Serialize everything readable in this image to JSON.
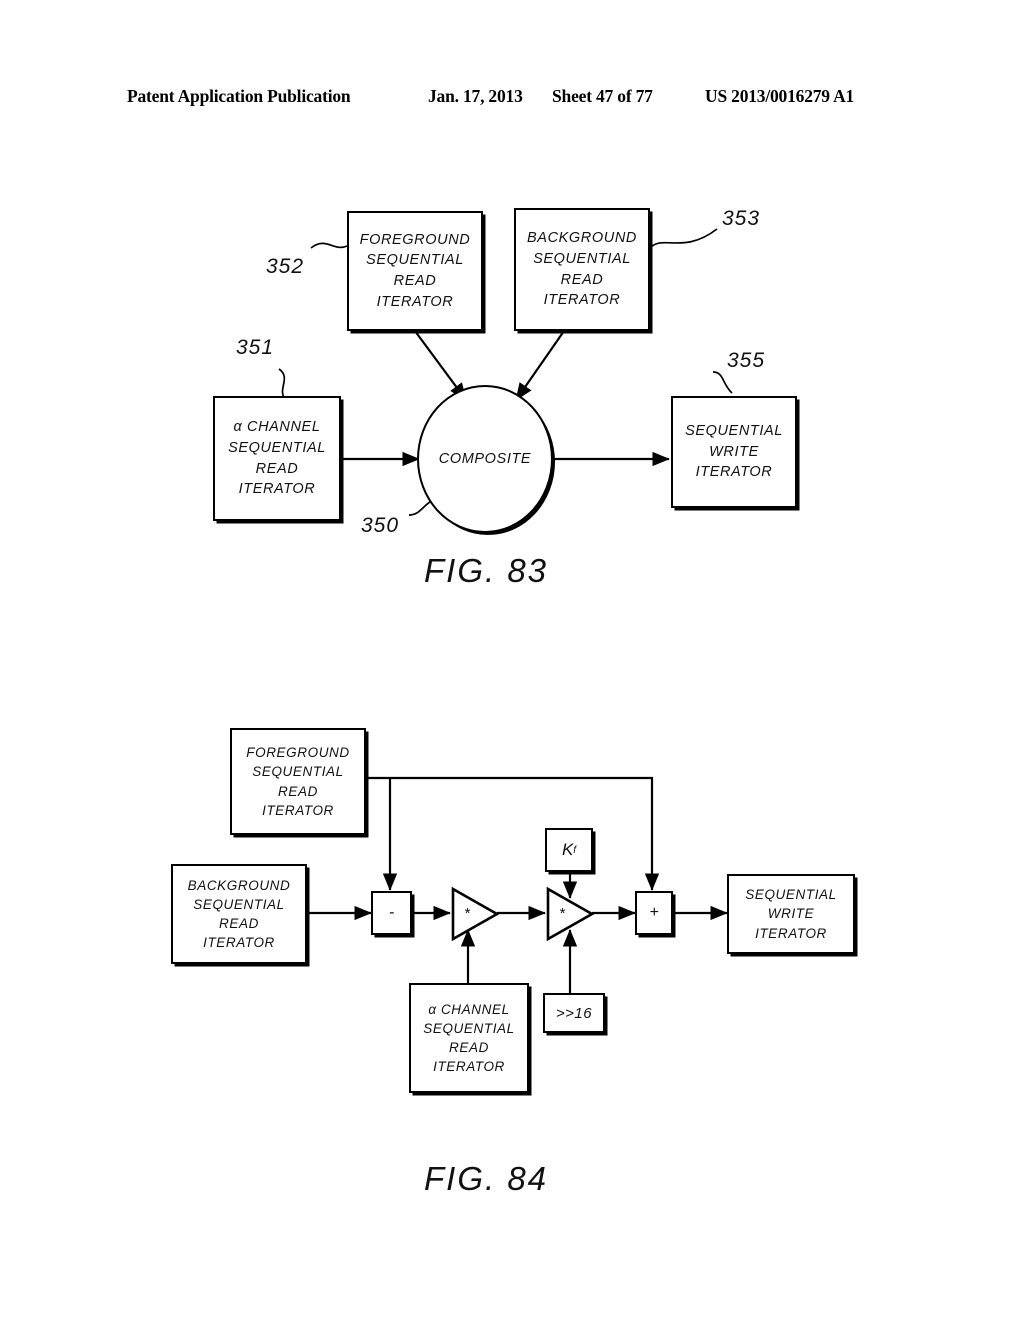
{
  "header": {
    "publication": "Patent Application Publication",
    "date": "Jan. 17, 2013",
    "sheet": "Sheet 47 of 77",
    "number": "US 2013/0016279 A1"
  },
  "figures": [
    {
      "id": "fig-83",
      "caption": "FIG. 83",
      "nodes": {
        "foreground_iterator": [
          "FOREGROUND",
          "SEQUENTIAL",
          "READ",
          "ITERATOR"
        ],
        "background_iterator": [
          "BACKGROUND",
          "SEQUENTIAL",
          "READ",
          "ITERATOR"
        ],
        "alpha_iterator": [
          "α CHANNEL",
          "SEQUENTIAL",
          "READ",
          "ITERATOR"
        ],
        "composite": "COMPOSITE",
        "write_iterator": [
          "SEQUENTIAL",
          "WRITE",
          "ITERATOR"
        ]
      },
      "refs": {
        "alpha": "351",
        "foreground": "352",
        "background": "353",
        "composite": "350",
        "write": "355"
      }
    },
    {
      "id": "fig-84",
      "caption": "FIG. 84",
      "nodes": {
        "foreground_iterator": [
          "FOREGROUND",
          "SEQUENTIAL",
          "READ",
          "ITERATOR"
        ],
        "background_iterator": [
          "BACKGROUND",
          "SEQUENTIAL",
          "READ",
          "ITERATOR"
        ],
        "alpha_iterator": [
          "α CHANNEL",
          "SEQUENTIAL",
          "READ",
          "ITERATOR"
        ],
        "write_iterator": [
          "SEQUENTIAL",
          "WRITE",
          "ITERATOR"
        ],
        "subtract_op": "-",
        "multiply_op_1": "*",
        "multiply_op_2": "*",
        "add_op": "+",
        "constant_k": "K",
        "constant_k_subscript": "f",
        "shift_op": ">>16"
      }
    }
  ]
}
